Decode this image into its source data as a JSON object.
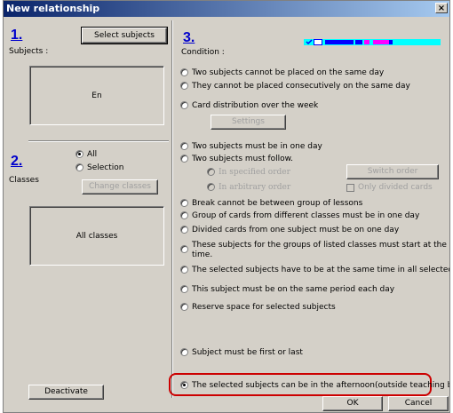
{
  "window": {
    "title": "New relationship",
    "close": "×"
  },
  "left": {
    "step1": "1.",
    "select_subjects": "Select subjects",
    "subjects_label": "Subjects :",
    "subjects_value": "En",
    "step2": "2.",
    "classes_label": "Classes",
    "radio_all": "All",
    "radio_selection": "Selection",
    "change_classes": "Change classes",
    "classes_value": "All classes",
    "deactivate": "Deactivate"
  },
  "right": {
    "step3": "3.",
    "condition_label": "Condition :",
    "opt_same_day": "Two subjects cannot be placed on the same day",
    "opt_consecutive": "They cannot be placed consecutively on the same day",
    "opt_distribution": "Card distribution over the week",
    "settings": "Settings",
    "opt_one_day": "Two subjects must be in one day",
    "opt_follow": "Two subjects must follow.",
    "opt_specified_order": "In specified order",
    "switch_order": "Switch order",
    "opt_arbitrary_order": "In arbitrary order",
    "only_divided": "Only divided cards",
    "opt_break": "Break cannot be between group of lessons",
    "opt_group_cards": "Group of cards from different classes must be in one day",
    "opt_divided_one_day": "Divided cards from one subject must be on one day",
    "opt_groups_start_1": "These subjects for the groups of listed classes must start at the same",
    "opt_groups_start_2": "time.",
    "opt_same_time": "The selected subjects have to be at the same time in all selected classes.",
    "opt_same_period": "This subject must be on the same period each day",
    "opt_reserve": "Reserve space for selected subjects",
    "opt_first_last": "Subject must be first or last",
    "opt_afternoon": "The selected subjects can be in the afternoon(outside teaching block)"
  },
  "footer": {
    "ok": "OK",
    "cancel": "Cancel"
  },
  "colors": {
    "accent_blue": "#0000cc",
    "highlight_red": "#cc0000",
    "dialog_bg": "#d4d0c8",
    "strip_cyan": "#00ffff",
    "strip_blue": "#0000ff",
    "strip_magenta": "#ff00ff"
  }
}
